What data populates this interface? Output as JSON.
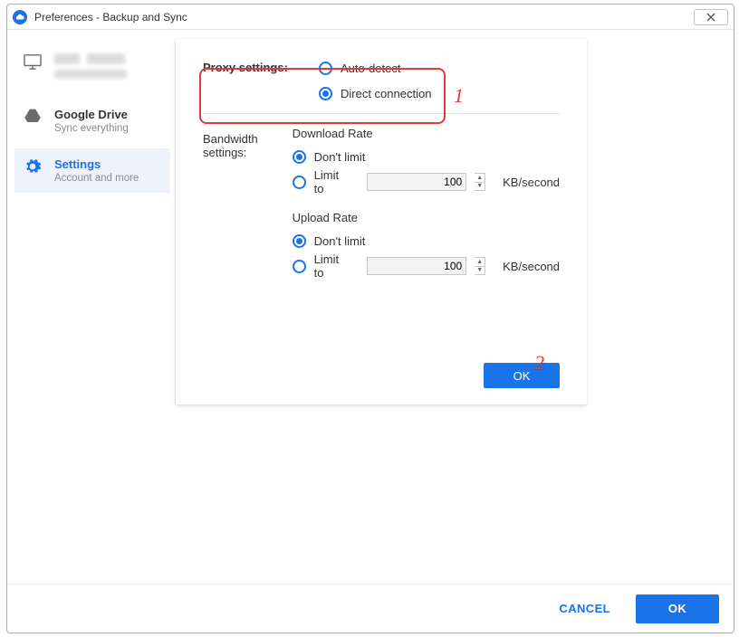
{
  "window": {
    "title": "Preferences - Backup and Sync"
  },
  "sidebar": {
    "items": [
      {
        "title": "",
        "subtitle": ""
      },
      {
        "title": "Google Drive",
        "subtitle": "Sync everything"
      },
      {
        "title": "Settings",
        "subtitle": "Account and more"
      }
    ]
  },
  "proxy": {
    "label": "Proxy settings:",
    "auto_detect": "Auto-detect",
    "direct": "Direct connection"
  },
  "bandwidth": {
    "label": "Bandwidth settings:",
    "download": {
      "heading": "Download Rate",
      "dont_limit": "Don't limit",
      "limit_to": "Limit to",
      "value": "100",
      "unit": "KB/second"
    },
    "upload": {
      "heading": "Upload Rate",
      "dont_limit": "Don't limit",
      "limit_to": "Limit to",
      "value": "100",
      "unit": "KB/second"
    }
  },
  "buttons": {
    "ok_inner": "OK",
    "cancel": "CANCEL",
    "ok_footer": "OK"
  },
  "annotations": {
    "one": "1",
    "two": "2"
  }
}
